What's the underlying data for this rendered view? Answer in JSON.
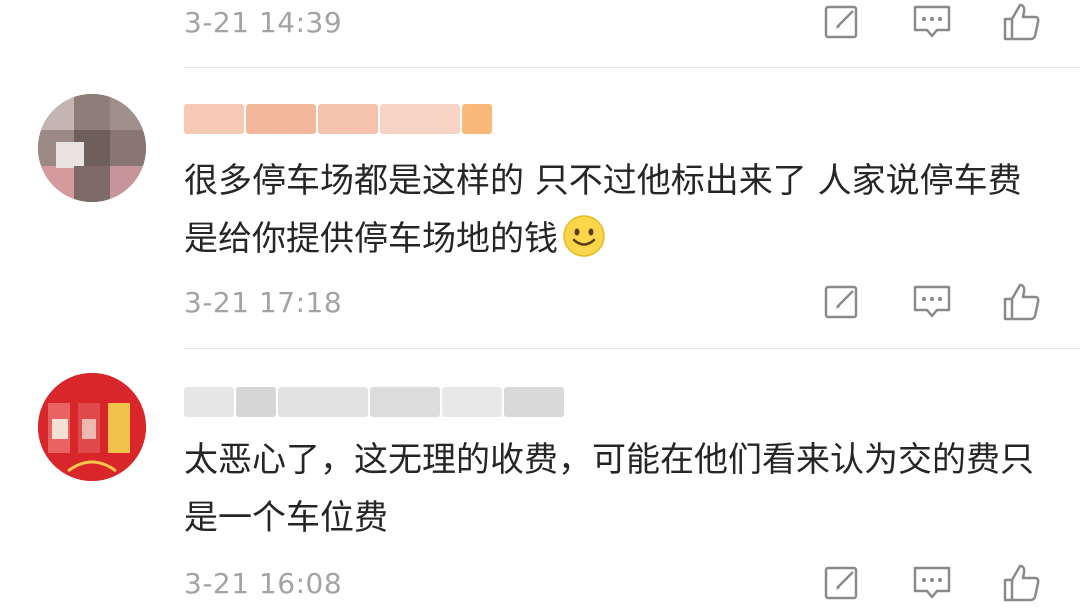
{
  "comments": [
    {
      "timestamp": "3-21 14:39",
      "text": ""
    },
    {
      "timestamp": "3-21 17:18",
      "text": "很多停车场都是这样的 只不过他标出来了 人家说停车费是给你提供停车场地的钱",
      "has_emoji": true,
      "emoji_name": "smile-emoji"
    },
    {
      "timestamp": "3-21 16:08",
      "text": "太恶心了，这无理的收费，可能在他们看来认为交的费只是一个车位费"
    }
  ],
  "colors": {
    "meta_text": "#a3a3a3",
    "icon": "#8a8a8a",
    "divider": "#e8e8e8"
  },
  "icons": [
    "edit-icon",
    "comment-icon",
    "like-icon"
  ]
}
